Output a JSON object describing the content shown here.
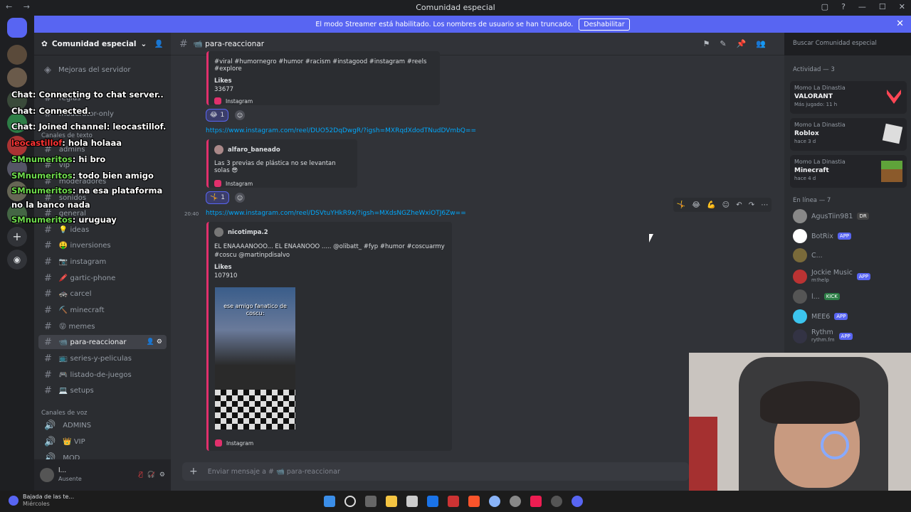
{
  "window": {
    "title": "Comunidad especial"
  },
  "banner": {
    "text": "El modo Streamer está habilitado. Los nombres de usuario se han truncado.",
    "button": "Deshabilitar"
  },
  "server": {
    "name": "Comunidad especial",
    "top_items": [
      "Mejoras del servidor"
    ],
    "channels": [
      {
        "label": "reglas"
      },
      {
        "label": "moderator-only"
      },
      {
        "label": "admins"
      },
      {
        "label": "vip"
      },
      {
        "label": "moderadores"
      },
      {
        "label": "sonidos"
      },
      {
        "label": "general"
      },
      {
        "label": "💡 ideas"
      },
      {
        "label": "🤑 inversiones"
      },
      {
        "label": "📷 instagram"
      },
      {
        "label": "🖍️ gartic-phone"
      },
      {
        "label": "🚓 carcel"
      },
      {
        "label": "⛏️ minecraft"
      },
      {
        "label": "😝 memes"
      },
      {
        "label": "📹 para-reaccionar"
      },
      {
        "label": "📺 series-y-peliculas"
      },
      {
        "label": "🎮 listado-de-juegos"
      },
      {
        "label": "💻 setups"
      }
    ],
    "cat_text": "Canales de texto",
    "cat_voice": "Canales de voz",
    "voice_channels": [
      {
        "label": "ADMINS"
      },
      {
        "label": "👑 VIP"
      },
      {
        "label": "MOD"
      }
    ]
  },
  "user": {
    "name": "l...",
    "status": "Ausente"
  },
  "channel": {
    "name": "📹 para-reaccionar"
  },
  "search": {
    "placeholder": "Buscar Comunidad especial"
  },
  "messages": {
    "embed1": {
      "hashtags": "#viral #humornegro #humor #racism #instagood #instagram #reels #explore",
      "likes_label": "Likes",
      "likes": "33677",
      "source": "Instagram"
    },
    "react1": {
      "emoji": "😂",
      "count": "1"
    },
    "link2": "https://www.instagram.com/reel/DUO52DqDwgR/?igsh=MXRqdXdodTNudDVmbQ==",
    "embed2": {
      "author": "alfaro_baneado",
      "text": "Las 3 previas de plástica no se levantan solas 😎",
      "source": "Instagram"
    },
    "react2": {
      "emoji": "🤸",
      "count": "1"
    },
    "time3": "20:40",
    "link3": "https://www.instagram.com/reel/DSVtuYHkR9x/?igsh=MXdsNGZheWxiOTJ6Zw==",
    "embed3": {
      "author": "nicotimpa.2",
      "text": "EL ENAAAANOOO... EL ENAANOOO ..... @olibatt_ #fyp #humor #coscuarmy #coscu @martinpdisalvo",
      "likes_label": "Likes",
      "likes": "107910",
      "video_caption": "ese amigo fanatico de coscu:",
      "source": "Instagram"
    }
  },
  "composer": {
    "placeholder": "Enviar mensaje a # 📹 para-reaccionar"
  },
  "activity": {
    "header": "Actividad — 3",
    "items": [
      {
        "who": "Momo La Dinastia",
        "game": "VALORANT",
        "when": "Más jugado: 11 h"
      },
      {
        "who": "Momo La Dinastia",
        "game": "Roblox",
        "when": "hace 3 d"
      },
      {
        "who": "Momo La Dinastia",
        "game": "Minecraft",
        "when": "hace 4 d"
      }
    ]
  },
  "online": {
    "header": "En línea — 7",
    "members": [
      {
        "name": "AgusTiin981",
        "tag": "DR",
        "sub": ""
      },
      {
        "name": "BotRix",
        "tag": "APP",
        "sub": ""
      },
      {
        "name": "C...",
        "tag": "",
        "sub": ""
      },
      {
        "name": "Jockie Music",
        "tag": "APP",
        "sub": "m!help"
      },
      {
        "name": "l...",
        "tag": "KICK",
        "sub": ""
      },
      {
        "name": "MEE6",
        "tag": "APP",
        "sub": ""
      },
      {
        "name": "Rythm",
        "tag": "APP",
        "sub": "rythm.fm"
      }
    ]
  },
  "chat_overlay": [
    {
      "user": "",
      "msg": "Chat: Connecting to chat server.."
    },
    {
      "user": "",
      "msg": "Chat: Connected."
    },
    {
      "user": "",
      "msg": "Chat: Joined channel: leocastillof."
    },
    {
      "user": "leocastillof",
      "msg": ": hola holaaa"
    },
    {
      "user": "SMnumeritos",
      "msg": ": hi bro"
    },
    {
      "user": "SMnumeritos",
      "msg": ": todo bien amigo"
    },
    {
      "user": "SMnumeritos",
      "msg": ": na esa plataforma no la banco nada"
    },
    {
      "user": "SMnumeritos",
      "msg": ": uruguay"
    }
  ],
  "taskbar": {
    "weather": "Bajada de las te...",
    "weather_sub": "Miércoles"
  }
}
